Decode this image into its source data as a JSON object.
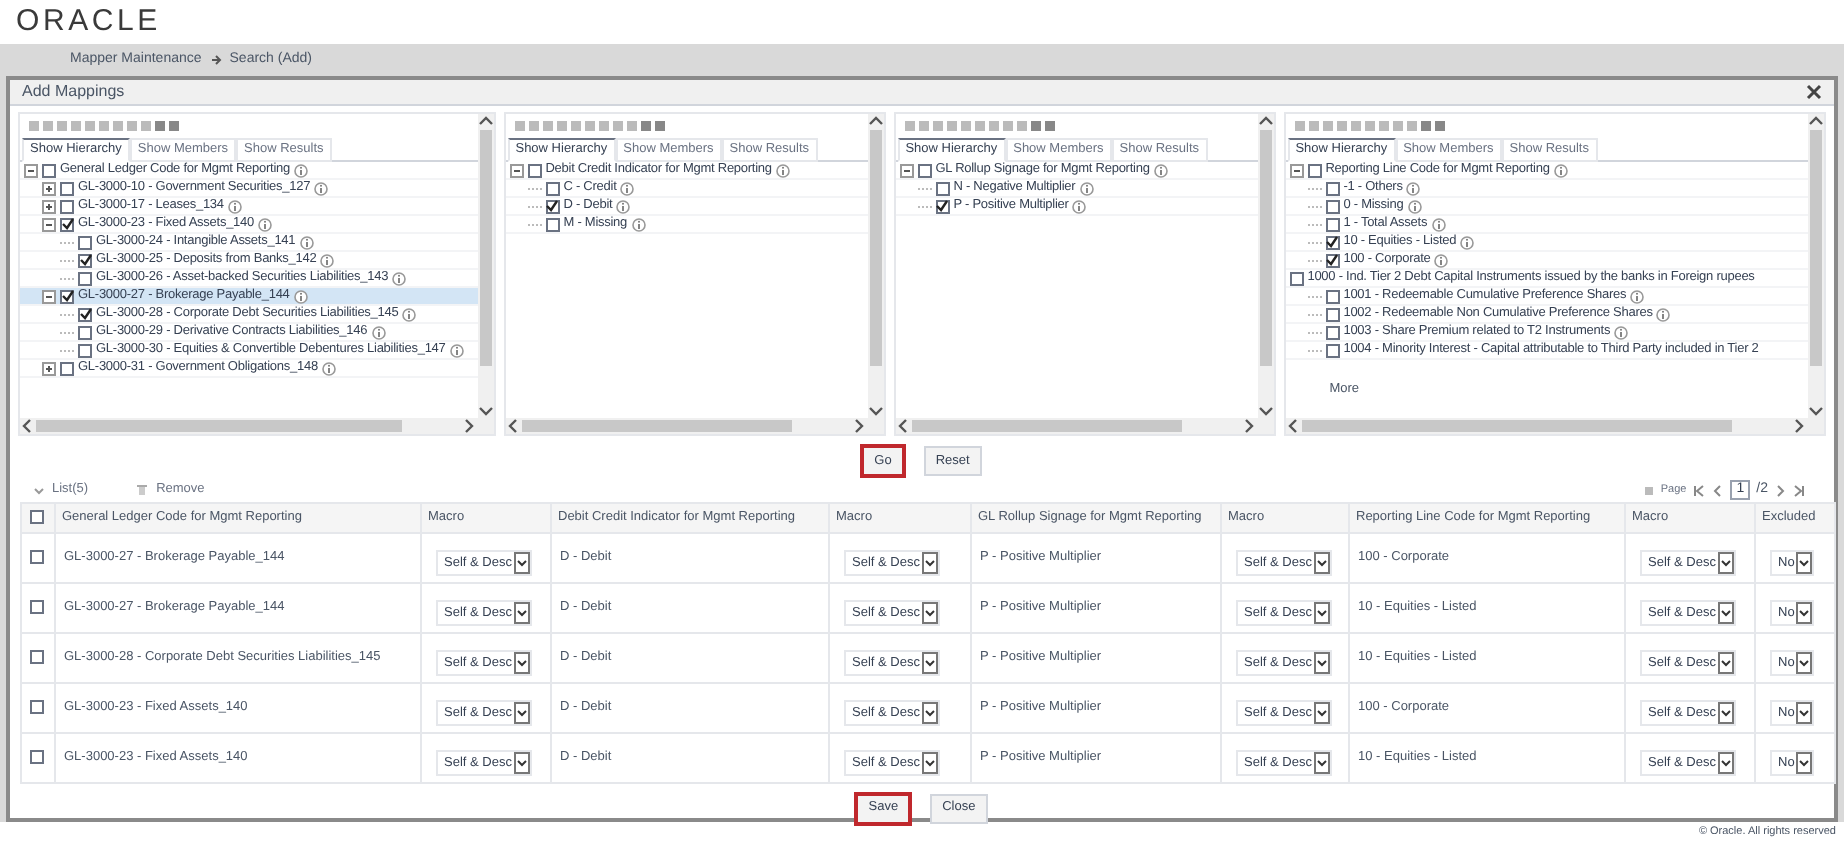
{
  "header": {
    "logo": "ORACLE"
  },
  "breadcrumb": [
    "Mapper Maintenance",
    "Search (Add)"
  ],
  "dialog": {
    "title": "Add Mappings",
    "panels": [
      {
        "tabs": [
          {
            "label": "Show Hierarchy",
            "selected": true
          },
          {
            "label": "Show Members",
            "selected": false
          },
          {
            "label": "Show Results",
            "selected": false
          }
        ],
        "tree": [
          {
            "label": "General Ledger Code for Mgmt Reporting",
            "checked": false,
            "selected": false,
            "expanded": true,
            "children": [
              {
                "label": "GL-3000-10 - Government Securities_127",
                "checked": false,
                "selected": false,
                "expanded": false
              },
              {
                "label": "GL-3000-17 - Leases_134",
                "checked": false,
                "selected": false,
                "expanded": false
              },
              {
                "label": "GL-3000-23 - Fixed Assets_140",
                "checked": true,
                "selected": false,
                "expanded": true,
                "children": [
                  {
                    "label": "GL-3000-24 - Intangible Assets_141",
                    "checked": false,
                    "selected": false
                  },
                  {
                    "label": "GL-3000-25 - Deposits from Banks_142",
                    "checked": true,
                    "selected": false
                  },
                  {
                    "label": "GL-3000-26 - Asset-backed Securities Liabilities_143",
                    "checked": false,
                    "selected": false
                  }
                ]
              },
              {
                "label": "GL-3000-27 - Brokerage Payable_144",
                "checked": true,
                "selected": true,
                "expanded": true,
                "children": [
                  {
                    "label": "GL-3000-28 - Corporate Debt Securities Liabilities_145",
                    "checked": true,
                    "selected": false
                  },
                  {
                    "label": "GL-3000-29 - Derivative Contracts Liabilities_146",
                    "checked": false,
                    "selected": false
                  },
                  {
                    "label": "GL-3000-30 - Equities & Convertible Debentures Liabilities_147",
                    "checked": false,
                    "selected": false
                  }
                ]
              },
              {
                "label": "GL-3000-31 - Government Obligations_148",
                "checked": false,
                "selected": false,
                "expanded": false
              }
            ]
          }
        ]
      },
      {
        "tabs": [
          {
            "label": "Show Hierarchy",
            "selected": true
          },
          {
            "label": "Show Members",
            "selected": false
          },
          {
            "label": "Show Results",
            "selected": false
          }
        ],
        "tree": [
          {
            "label": "Debit Credit Indicator for Mgmt Reporting",
            "checked": false,
            "selected": false,
            "expanded": true,
            "children": [
              {
                "label": "C - Credit",
                "checked": false,
                "selected": false
              },
              {
                "label": "D - Debit",
                "checked": true,
                "selected": false
              },
              {
                "label": "M - Missing",
                "checked": false,
                "selected": false
              }
            ]
          }
        ]
      },
      {
        "tabs": [
          {
            "label": "Show Hierarchy",
            "selected": true
          },
          {
            "label": "Show Members",
            "selected": false
          },
          {
            "label": "Show Results",
            "selected": false
          }
        ],
        "tree": [
          {
            "label": "GL Rollup Signage for Mgmt Reporting",
            "checked": false,
            "selected": false,
            "expanded": true,
            "children": [
              {
                "label": "N - Negative Multiplier",
                "checked": false,
                "selected": false
              },
              {
                "label": "P - Positive Multiplier",
                "checked": true,
                "selected": false
              }
            ]
          }
        ]
      },
      {
        "tabs": [
          {
            "label": "Show Hierarchy",
            "selected": true
          },
          {
            "label": "Show Members",
            "selected": false
          },
          {
            "label": "Show Results",
            "selected": false
          }
        ],
        "tree": [
          {
            "label": "Reporting Line Code for Mgmt Reporting",
            "checked": false,
            "selected": false,
            "expanded": true,
            "children": [
              {
                "label": "-1 - Others",
                "checked": false,
                "selected": false
              },
              {
                "label": "0 - Missing",
                "checked": false,
                "selected": false
              },
              {
                "label": "1 - Total Assets",
                "checked": false,
                "selected": false
              },
              {
                "label": "10 - Equities - Listed",
                "checked": true,
                "selected": false
              },
              {
                "label": "100 - Corporate",
                "checked": true,
                "selected": false
              }
            ]
          },
          {
            "label": "1000 - Ind. Tier 2 Debt Capital Instruments issued by the banks in Foreign rupees",
            "checked": false,
            "selected": false,
            "info": false,
            "children": [
              {
                "label": "1001 - Redeemable Cumulative Preference Shares",
                "checked": false,
                "selected": false
              },
              {
                "label": "1002 - Redeemable Non Cumulative Preference Shares",
                "checked": false,
                "selected": false
              },
              {
                "label": "1003 - Share Premium related to T2 Instruments",
                "checked": false,
                "selected": false
              },
              {
                "label": "1004 - Minority Interest - Capital attributable to Third Party included in Tier 2",
                "checked": false,
                "selected": false,
                "info": false
              }
            ]
          }
        ],
        "more_link": "More"
      }
    ],
    "buttons": [
      {
        "label": "Go",
        "highlighted": true
      },
      {
        "label": "Reset",
        "highlighted": false
      }
    ],
    "list": {
      "title": "List(5)",
      "remove": "Remove",
      "pager": {
        "label": "Page",
        "current": "1",
        "total": "/2"
      },
      "select_all_checked": false,
      "columns": [
        {
          "label": "General Ledger Code for Mgmt Reporting",
          "kind": "text"
        },
        {
          "label": "Macro",
          "kind": "select"
        },
        {
          "label": "Debit Credit Indicator for Mgmt Reporting",
          "kind": "text"
        },
        {
          "label": "Macro",
          "kind": "select"
        },
        {
          "label": "GL Rollup Signage for Mgmt Reporting",
          "kind": "text"
        },
        {
          "label": "Macro",
          "kind": "select"
        },
        {
          "label": "Reporting Line Code for Mgmt Reporting",
          "kind": "text"
        },
        {
          "label": "Macro",
          "kind": "select"
        },
        {
          "label": "Excluded",
          "kind": "select"
        }
      ],
      "rows": [
        {
          "checked": false,
          "cells": [
            "GL-3000-27 - Brokerage Payable_144",
            "Self & Desc",
            "D - Debit",
            "Self & Desc",
            "P - Positive Multiplier",
            "Self & Desc",
            "100 - Corporate",
            "Self & Desc",
            "No"
          ]
        },
        {
          "checked": false,
          "cells": [
            "GL-3000-27 - Brokerage Payable_144",
            "Self & Desc",
            "D - Debit",
            "Self & Desc",
            "P - Positive Multiplier",
            "Self & Desc",
            "10 - Equities - Listed",
            "Self & Desc",
            "No"
          ]
        },
        {
          "checked": false,
          "cells": [
            "GL-3000-28 - Corporate Debt Securities Liabilities_145",
            "Self & Desc",
            "D - Debit",
            "Self & Desc",
            "P - Positive Multiplier",
            "Self & Desc",
            "10 - Equities - Listed",
            "Self & Desc",
            "No"
          ]
        },
        {
          "checked": false,
          "cells": [
            "GL-3000-23 - Fixed Assets_140",
            "Self & Desc",
            "D - Debit",
            "Self & Desc",
            "P - Positive Multiplier",
            "Self & Desc",
            "100 - Corporate",
            "Self & Desc",
            "No"
          ]
        },
        {
          "checked": false,
          "cells": [
            "GL-3000-23 - Fixed Assets_140",
            "Self & Desc",
            "D - Debit",
            "Self & Desc",
            "P - Positive Multiplier",
            "Self & Desc",
            "10 - Equities - Listed",
            "Self & Desc",
            "No"
          ]
        }
      ]
    },
    "footer_buttons": [
      {
        "label": "Save",
        "highlighted": true
      },
      {
        "label": "Close",
        "highlighted": false
      }
    ]
  },
  "footer": "© Oracle. All rights reserved"
}
